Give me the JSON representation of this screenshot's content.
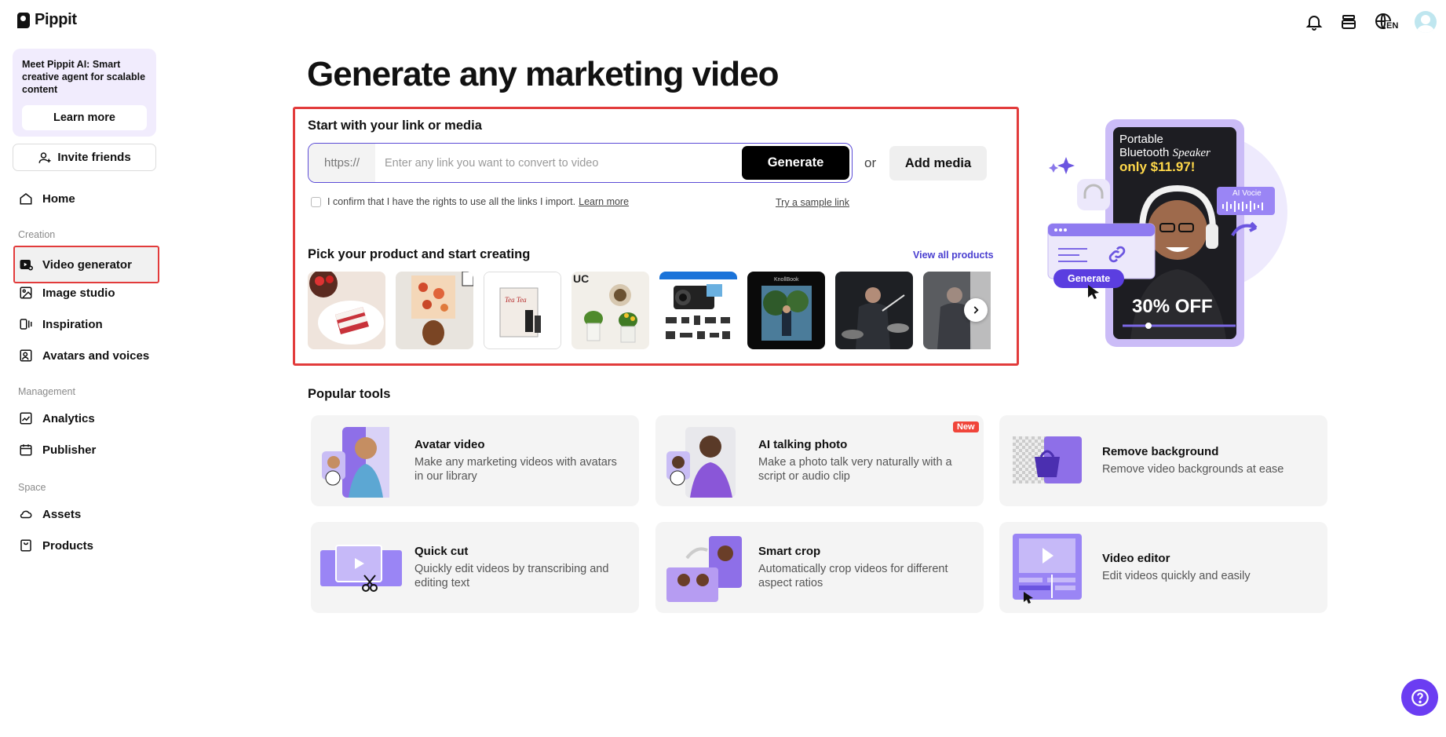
{
  "app": {
    "name": "Pippit"
  },
  "sidebar": {
    "promo_text": "Meet Pippit AI: Smart creative agent for scalable content",
    "promo_button": "Learn more",
    "invite_label": "Invite friends",
    "home_label": "Home",
    "sections": {
      "creation": "Creation",
      "management": "Management",
      "space": "Space"
    },
    "items": {
      "video_generator": "Video generator",
      "image_studio": "Image studio",
      "inspiration": "Inspiration",
      "avatars": "Avatars and voices",
      "analytics": "Analytics",
      "publisher": "Publisher",
      "assets": "Assets",
      "products": "Products"
    },
    "active_item": "Video generator"
  },
  "topbar": {
    "language": "EN",
    "icons": [
      "bell-icon",
      "layers-icon",
      "globe-icon",
      "avatar"
    ]
  },
  "main": {
    "title": "Generate any marketing video",
    "link_section_title": "Start with your link or media",
    "url_prefix": "https://",
    "url_placeholder": "Enter any link you want to convert to video",
    "url_value": "",
    "generate_label": "Generate",
    "or_label": "or",
    "add_media_label": "Add media",
    "confirm_text": "I confirm that I have the rights to use all the links I import.",
    "confirm_learn_more": "Learn more",
    "confirm_checked": false,
    "sample_link": "Try a sample link",
    "products_title": "Pick your product and start creating",
    "view_all": "View all products",
    "product_thumbnails": [
      "cake",
      "lamp",
      "tea-box",
      "plant-vases",
      "camera-kit",
      "outdoor-person",
      "drummer",
      "drummer-2"
    ]
  },
  "hero": {
    "product_line1": "Portable",
    "product_line2": "Bluetooth",
    "product_line2_italic": "Speaker",
    "price": "only $11.97!",
    "discount": "30% OFF",
    "ai_label": "AI Vocie",
    "generate_label": "Generate"
  },
  "popular": {
    "title": "Popular tools",
    "tools": [
      {
        "title": "Avatar video",
        "desc": "Make any marketing videos with avatars in our library"
      },
      {
        "title": "AI talking photo",
        "desc": "Make a photo talk very naturally with a script or audio clip",
        "badge": "New"
      },
      {
        "title": "Remove background",
        "desc": "Remove video backgrounds at ease"
      },
      {
        "title": "Quick cut",
        "desc": "Quickly edit videos by transcribing and editing text"
      },
      {
        "title": "Smart crop",
        "desc": "Automatically crop videos for different aspect ratios"
      },
      {
        "title": "Video editor",
        "desc": "Edit videos quickly and easily"
      }
    ]
  },
  "colors": {
    "accent": "#5b4bd6",
    "highlight": "#e23b3b",
    "card_bg": "#f4f4f4",
    "help": "#6b3df2"
  }
}
